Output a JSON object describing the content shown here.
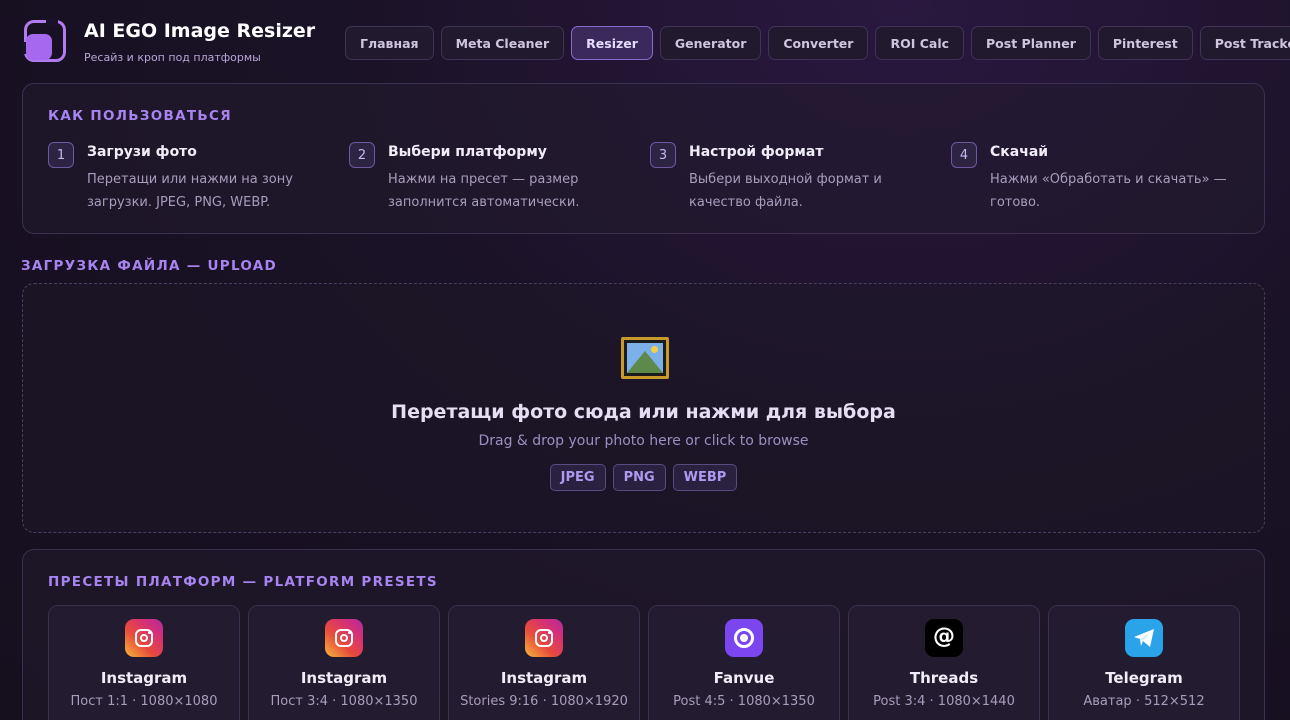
{
  "header": {
    "title": "AI EGO Image Resizer",
    "subtitle": "Ресайз и кроп под платформы"
  },
  "nav": [
    {
      "label": "Главная",
      "active": false
    },
    {
      "label": "Meta Cleaner",
      "active": false
    },
    {
      "label": "Resizer",
      "active": true
    },
    {
      "label": "Generator",
      "active": false
    },
    {
      "label": "Converter",
      "active": false
    },
    {
      "label": "ROI Calc",
      "active": false
    },
    {
      "label": "Post Planner",
      "active": false
    },
    {
      "label": "Pinterest",
      "active": false
    },
    {
      "label": "Post Tracker",
      "active": false
    }
  ],
  "how_to": {
    "title": "КАК ПОЛЬЗОВАТЬСЯ",
    "steps": [
      {
        "num": "1",
        "title": "Загрузи фото",
        "desc": "Перетащи или нажми на зону загрузки. JPEG, PNG, WEBP."
      },
      {
        "num": "2",
        "title": "Выбери платформу",
        "desc": "Нажми на пресет — размер заполнится автоматически."
      },
      {
        "num": "3",
        "title": "Настрой формат",
        "desc": "Выбери выходной формат и качество файла."
      },
      {
        "num": "4",
        "title": "Скачай",
        "desc": "Нажми «Обработать и скачать» — готово."
      }
    ]
  },
  "upload": {
    "label": "ЗАГРУЗКА ФАЙЛА — UPLOAD",
    "icon": "framed-picture-icon",
    "main_text": "Перетащи фото сюда или нажми для выбора",
    "sub_text": "Drag & drop your photo here or click to browse",
    "formats": [
      "JPEG",
      "PNG",
      "WEBP"
    ]
  },
  "presets": {
    "title": "ПРЕСЕТЫ ПЛАТФОРМ — PLATFORM PRESETS",
    "items": [
      {
        "name": "Instagram",
        "size": "Пост 1:1 · 1080×1080",
        "icon": "instagram-icon"
      },
      {
        "name": "Instagram",
        "size": "Пост 3:4 · 1080×1350",
        "icon": "instagram-icon"
      },
      {
        "name": "Instagram",
        "size": "Stories 9:16 · 1080×1920",
        "icon": "instagram-icon"
      },
      {
        "name": "Fanvue",
        "size": "Post 4:5 · 1080×1350",
        "icon": "fanvue-icon"
      },
      {
        "name": "Threads",
        "size": "Post 3:4 · 1080×1440",
        "icon": "threads-icon"
      },
      {
        "name": "Telegram",
        "size": "Аватар · 512×512",
        "icon": "telegram-icon"
      }
    ]
  },
  "colors": {
    "accent": "#a884f0",
    "background": "#1a1226",
    "instagram": "#d32e7a",
    "fanvue": "#7b45f0",
    "telegram": "#2aa3e8"
  }
}
